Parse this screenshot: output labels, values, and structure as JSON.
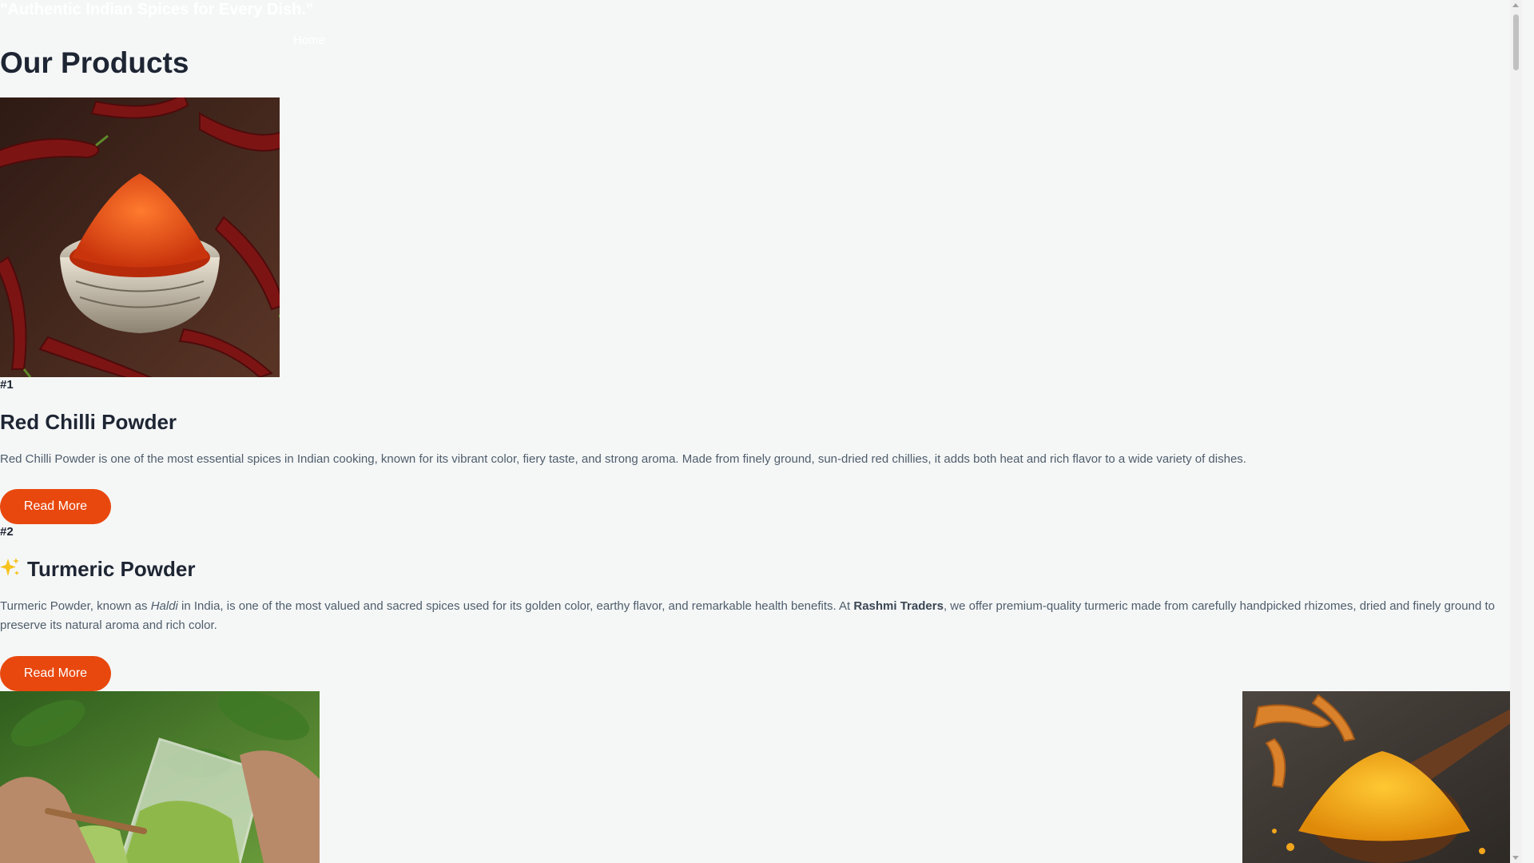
{
  "header": {
    "tagline": "\"Authentic Indian Spices for Every Dish.\"",
    "nav_home": "Home"
  },
  "products_section": {
    "heading": "Our Products",
    "items": [
      {
        "rank": "#1",
        "title": "Red Chilli Powder",
        "description": "Red Chilli Powder is one of the most essential spices in Indian cooking, known for its vibrant color, fiery taste, and strong aroma. Made from finely ground, sun-dried red chillies, it adds both heat and rich flavor to a wide variety of dishes.",
        "button_label": "Read More",
        "image_icon": "red-chilli-powder-photo"
      },
      {
        "rank": "#2",
        "title": "Turmeric Powder",
        "title_icon": "sparkles-icon",
        "desc_part1": "Turmeric Powder, known as ",
        "desc_em": "Haldi",
        "desc_part2": " in India, is one of the most valued and sacred spices used for its golden color, earthy flavor, and remarkable health benefits. At ",
        "desc_strong": "Rashmi Traders",
        "desc_part3": ", we offer premium-quality turmeric made from carefully handpicked rhizomes, dried and finely ground to preserve its natural aroma and rich color.",
        "button_label": "Read More"
      }
    ]
  },
  "colors": {
    "accent": "#e8480e",
    "heading_text": "#1e2533",
    "body_text": "#4f5d6b",
    "page_bg": "#f5f7f7"
  }
}
